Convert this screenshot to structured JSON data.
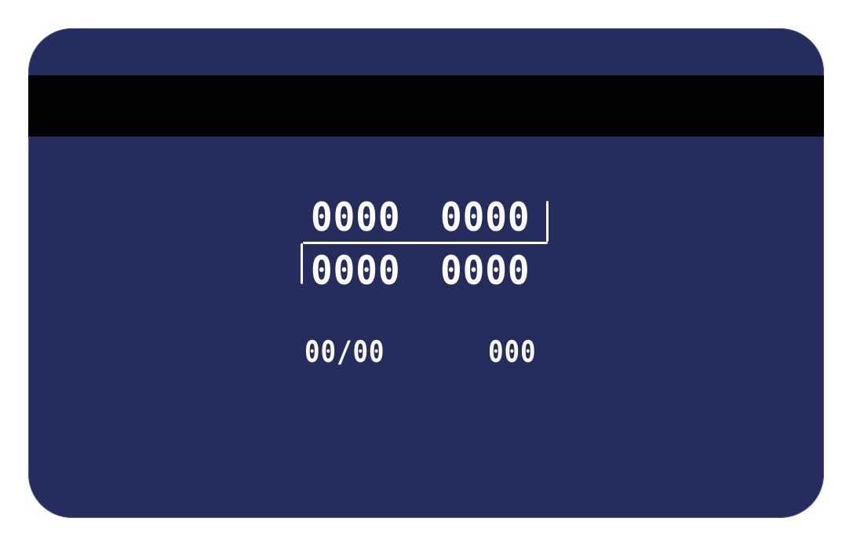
{
  "card": {
    "number_groups": [
      "0000",
      "0000",
      "0000",
      "0000"
    ],
    "expiry": "00/00",
    "cvv": "000"
  },
  "colors": {
    "page_background": "#ffffff",
    "card_background": "#252d5e",
    "magnetic_stripe": "#030305",
    "text": "#ffffff"
  }
}
